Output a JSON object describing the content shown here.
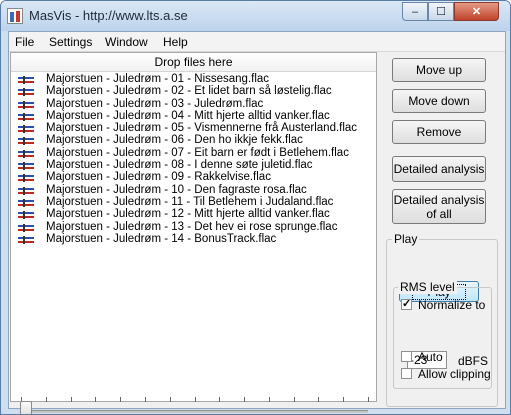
{
  "window": {
    "title": "MasVis - http://www.lts.a.se"
  },
  "titlebar_buttons": {
    "minimize": "–",
    "maximize": "☐",
    "close": "✕"
  },
  "menu": [
    "File",
    "Settings",
    "Window",
    "Help"
  ],
  "filepanel": {
    "header": "Drop files here",
    "files": [
      "Majorstuen - Juledrøm - 01 - Nissesang.flac",
      "Majorstuen - Juledrøm - 02 - Et lidet barn så  løstelig.flac",
      "Majorstuen - Juledrøm - 03 - Juledrøm.flac",
      "Majorstuen - Juledrøm - 04 - Mitt hjerte alltid vanker.flac",
      "Majorstuen - Juledrøm - 05 - Vismennerne frå Austerland.flac",
      "Majorstuen - Juledrøm - 06 - Den ho ikkje fekk.flac",
      "Majorstuen - Juledrøm - 07 - Eit barn er født i Betlehem.flac",
      "Majorstuen - Juledrøm - 08 - I denne søte juletid.flac",
      "Majorstuen - Juledrøm - 09 - Rakkelvise.flac",
      "Majorstuen - Juledrøm - 10 - Den fagraste rosa.flac",
      "Majorstuen - Juledrøm - 11 - Til Betlehem i Judaland.flac",
      "Majorstuen - Juledrøm - 12 - Mitt hjerte alltid vanker.flac",
      "Majorstuen - Juledrøm - 13 - Det hev ei rose sprunge.flac",
      "Majorstuen - Juledrøm - 14 - BonusTrack.flac"
    ]
  },
  "slider": {
    "value": 0
  },
  "buttons": {
    "move_up": "Move up",
    "move_down": "Move down",
    "remove": "Remove",
    "detailed": "Detailed analysis",
    "detailed_all_1": "Detailed analysis",
    "detailed_all_2": "of all"
  },
  "play_group": {
    "label": "Play",
    "play_button": "Play",
    "rms": {
      "label": "RMS level",
      "normalize_label": "Normalize to",
      "normalize_checked": true,
      "value": "-23",
      "unit": "dBFS",
      "auto_label": "Auto",
      "auto_checked": false,
      "clipping_label": "Allow clipping",
      "clipping_checked": false
    }
  }
}
